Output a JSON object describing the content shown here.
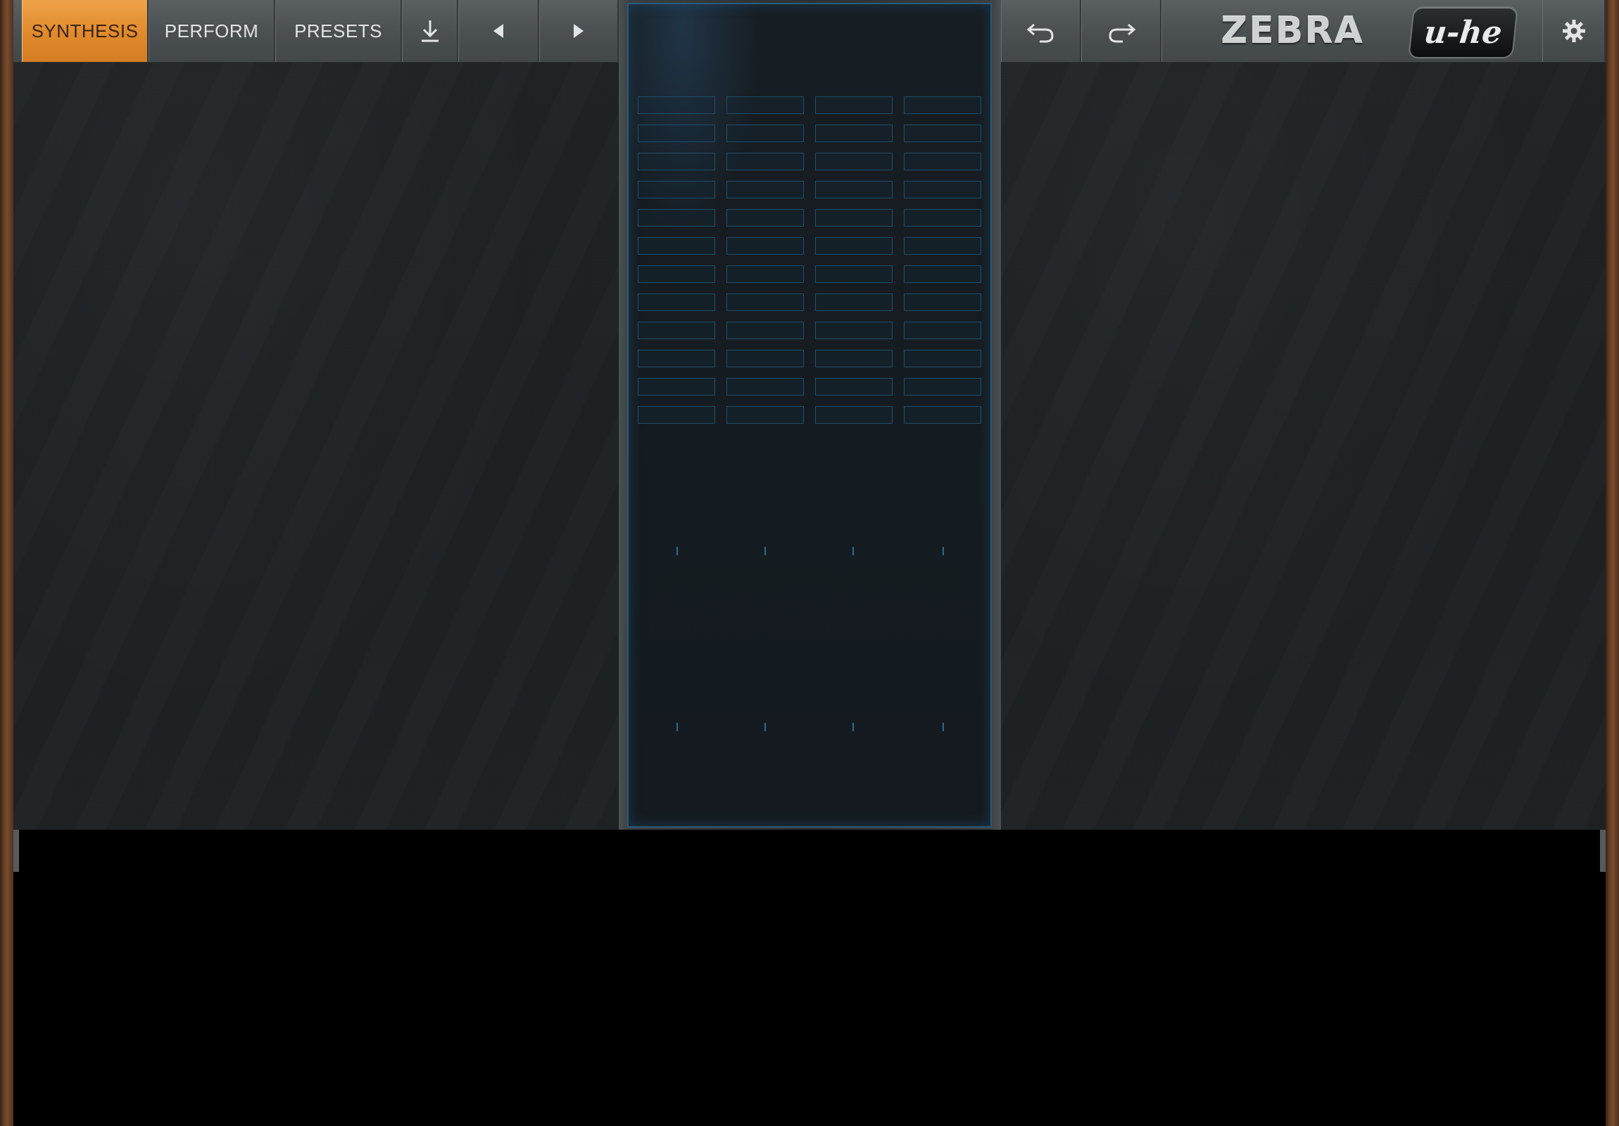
{
  "toolbar": {
    "tabs": [
      {
        "label": "SYNTHESIS",
        "active": true
      },
      {
        "label": "PERFORM",
        "active": false
      },
      {
        "label": "PRESETS",
        "active": false
      }
    ],
    "icons": {
      "save": "download-icon",
      "prev": "triangle-left-icon",
      "next": "triangle-right-icon",
      "undo": "undo-icon",
      "redo": "redo-icon",
      "settings": "gear-icon"
    }
  },
  "branding": {
    "product": "ZEBRA",
    "vendor": "u-he"
  },
  "colors": {
    "accent": "#e8922f",
    "screen_border": "#2a5a78",
    "background": "#1d2022"
  }
}
